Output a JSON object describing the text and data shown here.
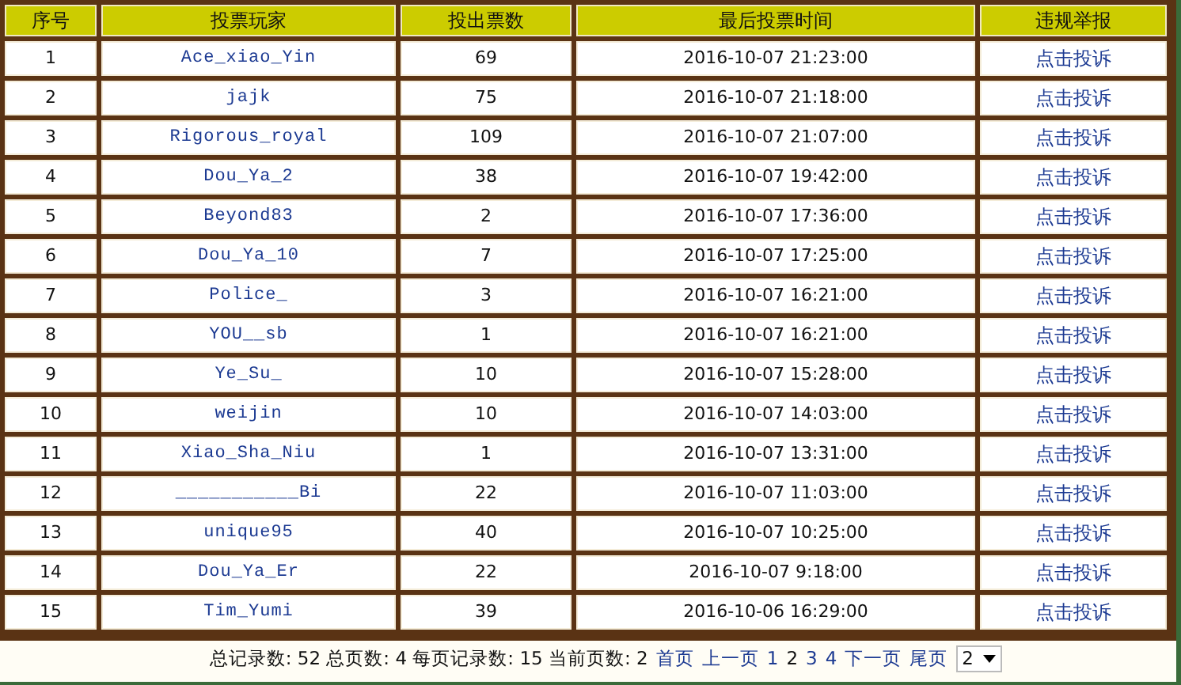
{
  "table": {
    "columns": [
      "序号",
      "投票玩家",
      "投出票数",
      "最后投票时间",
      "违规举报"
    ],
    "rows": [
      {
        "index": "1",
        "player": "Ace_xiao_Yin",
        "votes": "69",
        "time": "2016-10-07 21:23:00",
        "report": "点击投诉"
      },
      {
        "index": "2",
        "player": "jajk",
        "votes": "75",
        "time": "2016-10-07 21:18:00",
        "report": "点击投诉"
      },
      {
        "index": "3",
        "player": "Rigorous_royal",
        "votes": "109",
        "time": "2016-10-07 21:07:00",
        "report": "点击投诉"
      },
      {
        "index": "4",
        "player": "Dou_Ya_2",
        "votes": "38",
        "time": "2016-10-07 19:42:00",
        "report": "点击投诉"
      },
      {
        "index": "5",
        "player": "Beyond83",
        "votes": "2",
        "time": "2016-10-07 17:36:00",
        "report": "点击投诉"
      },
      {
        "index": "6",
        "player": "Dou_Ya_10",
        "votes": "7",
        "time": "2016-10-07 17:25:00",
        "report": "点击投诉"
      },
      {
        "index": "7",
        "player": "Police_",
        "votes": "3",
        "time": "2016-10-07 16:21:00",
        "report": "点击投诉"
      },
      {
        "index": "8",
        "player": "YOU__sb",
        "votes": "1",
        "time": "2016-10-07 16:21:00",
        "report": "点击投诉"
      },
      {
        "index": "9",
        "player": "Ye_Su_",
        "votes": "10",
        "time": "2016-10-07 15:28:00",
        "report": "点击投诉"
      },
      {
        "index": "10",
        "player": "weijin",
        "votes": "10",
        "time": "2016-10-07 14:03:00",
        "report": "点击投诉"
      },
      {
        "index": "11",
        "player": "Xiao_Sha_Niu",
        "votes": "1",
        "time": "2016-10-07 13:31:00",
        "report": "点击投诉"
      },
      {
        "index": "12",
        "player": "___________Bi",
        "votes": "22",
        "time": "2016-10-07 11:03:00",
        "report": "点击投诉"
      },
      {
        "index": "13",
        "player": "unique95",
        "votes": "40",
        "time": "2016-10-07 10:25:00",
        "report": "点击投诉"
      },
      {
        "index": "14",
        "player": "Dou_Ya_Er",
        "votes": "22",
        "time": "2016-10-07 9:18:00",
        "report": "点击投诉"
      },
      {
        "index": "15",
        "player": "Tim_Yumi",
        "votes": "39",
        "time": "2016-10-06 16:29:00",
        "report": "点击投诉"
      }
    ]
  },
  "pagination": {
    "summary": "总记录数: 52 总页数: 4 每页记录数: 15 当前页数: 2",
    "first": "首页",
    "prev": "上一页",
    "pages": [
      {
        "label": "1",
        "selected": false
      },
      {
        "label": "2",
        "selected": true
      },
      {
        "label": "3",
        "selected": false
      },
      {
        "label": "4",
        "selected": false
      }
    ],
    "next": "下一页",
    "last": "尾页",
    "page_select": "2"
  }
}
